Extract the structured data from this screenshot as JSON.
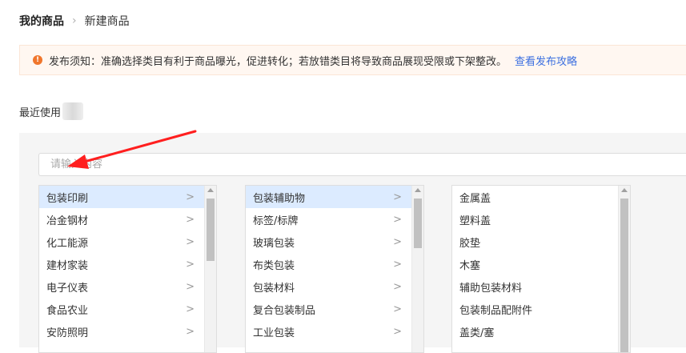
{
  "breadcrumb": {
    "current": "我的商品",
    "page": "新建商品"
  },
  "notice": {
    "text": "发布须知：准确选择类目有利于商品曝光，促进转化；若放错类目将导致商品展现受限或下架整改。",
    "link": "查看发布攻略",
    "icon_glyph": "!",
    "accent_color": "#f0762c",
    "link_color": "#3b6fe0"
  },
  "recent": {
    "label": "最近使用"
  },
  "search": {
    "placeholder": "请输入内容"
  },
  "columns": {
    "level1": [
      {
        "label": "包装印刷"
      },
      {
        "label": "冶金钢材"
      },
      {
        "label": "化工能源"
      },
      {
        "label": "建材家装"
      },
      {
        "label": "电子仪表"
      },
      {
        "label": "食品农业"
      },
      {
        "label": "安防照明"
      }
    ],
    "level2": [
      {
        "label": "包装辅助物"
      },
      {
        "label": "标签/标牌"
      },
      {
        "label": "玻璃包装"
      },
      {
        "label": "布类包装"
      },
      {
        "label": "包装材料"
      },
      {
        "label": "复合包装制品"
      },
      {
        "label": "工业包装"
      }
    ],
    "level3": [
      {
        "label": "金属盖"
      },
      {
        "label": "塑料盖"
      },
      {
        "label": "胶垫"
      },
      {
        "label": "木塞"
      },
      {
        "label": "辅助包装材料"
      },
      {
        "label": "包装制品配附件"
      },
      {
        "label": "盖类/塞"
      }
    ]
  },
  "chevron_glyph": ">",
  "selected_color": "#dcebff",
  "annotation_color": "#ff1f1f"
}
